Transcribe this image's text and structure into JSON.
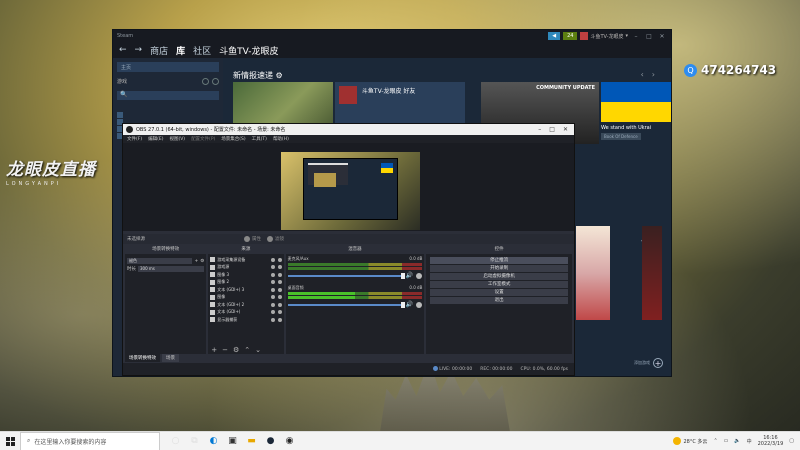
{
  "desktop": {
    "streamer_logo_text": "龙眼皮直播",
    "streamer_logo_sub": "LONGYANPI",
    "qq_number": "474264743"
  },
  "steam": {
    "topbar": {
      "menu": [
        "Steam"
      ],
      "btn_blue": "◀",
      "btn_green": "24",
      "username": "斗鱼TV-龙眼皮"
    },
    "nav": {
      "back": "←",
      "forward": "→",
      "items": [
        "商店",
        "库",
        "社区"
      ],
      "active_index": 1,
      "title": "斗鱼TV-龙眼皮"
    },
    "sidebar": {
      "home": "主页",
      "games_label": "游戏",
      "search_icon": "🔍"
    },
    "news_title": "新情报速递",
    "friend_card_name": "斗鱼TV-龙眼皮\n好友",
    "community_update": "COMMUNITY UPDATE",
    "ukraine_caption": "We stand with Ukrai",
    "ukraine_tag": "Book Of Defence",
    "add_game": "添加游戏"
  },
  "obs": {
    "title": "OBS 27.0.1 (64-bit, windows) - 配置文件: 未命名 - 场景: 未命名",
    "menu": [
      "文件(F)",
      "编辑(E)",
      "视图(V)",
      "配置文件(P)",
      "场景集合(S)",
      "工具(T)",
      "帮助(H)"
    ],
    "menu_disabled_index": 3,
    "status_row": {
      "no_source": "未选择源",
      "props": "属性",
      "filters": "滤镜"
    },
    "docks": {
      "scene_props_title": "场景转换特效",
      "sources_title": "来源",
      "mixer_title": "混音器",
      "controls_title": "控件"
    },
    "transition": {
      "type_label": "",
      "type_value": "褪色",
      "duration_label": "时长",
      "duration_value": "300 ms"
    },
    "sources": [
      "游戏采集源设备",
      "游戏源",
      "图像 3",
      "图像 2",
      "文本 (GDI+) 3",
      "图像",
      "文本 (GDI+) 2",
      "文本 (GDI+)",
      "显示器捕获"
    ],
    "mixer": [
      {
        "name": "麦克风/Aux",
        "db": "0.0 dB"
      },
      {
        "name": "桌面音频",
        "db": "0.0 dB"
      }
    ],
    "controls": [
      "停止推流",
      "开始录制",
      "启动虚拟摄像机",
      "工作室模式",
      "设置",
      "退出"
    ],
    "controls_active_index": 0,
    "tabs": [
      "场景转换特效",
      "场景"
    ],
    "statusbar": {
      "live": "LIVE:",
      "live_time": "00:00:00",
      "rec": "REC:",
      "rec_time": "00:00:00",
      "cpu": "CPU: 0.0%, 60.00 fps"
    }
  },
  "taskbar": {
    "search_placeholder": "在这里输入你要搜索的内容",
    "weather": "28°C 多云",
    "time": "16:16",
    "date": "2022/3/19"
  }
}
